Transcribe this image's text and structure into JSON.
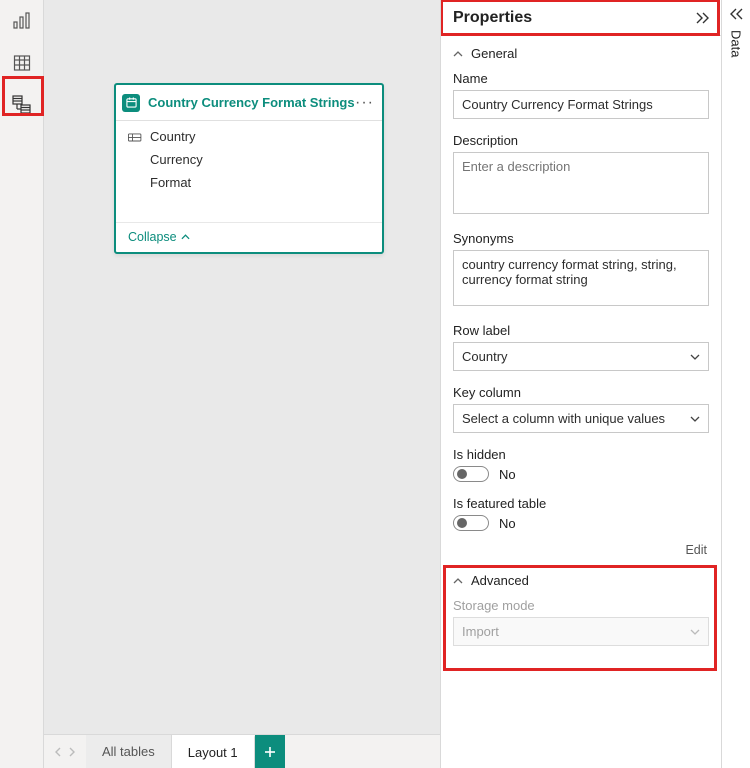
{
  "properties_panel": {
    "title": "Properties",
    "general_heading": "General",
    "name_label": "Name",
    "name_value": "Country Currency Format Strings",
    "description_label": "Description",
    "description_placeholder": "Enter a description",
    "description_value": "",
    "synonyms_label": "Synonyms",
    "synonyms_value": "country currency format string, string, currency format string",
    "row_label_label": "Row label",
    "row_label_value": "Country",
    "key_column_label": "Key column",
    "key_column_value": "Select a column with unique values",
    "is_hidden_label": "Is hidden",
    "is_hidden_value": "No",
    "is_featured_label": "Is featured table",
    "is_featured_value": "No",
    "edit_link": "Edit",
    "advanced_heading": "Advanced",
    "storage_mode_label": "Storage mode",
    "storage_mode_value": "Import"
  },
  "table_card": {
    "title": "Country Currency Format Strings",
    "fields": [
      "Country",
      "Currency",
      "Format"
    ],
    "collapse_label": "Collapse"
  },
  "tabs": {
    "all_tables": "All tables",
    "layout1": "Layout 1"
  },
  "data_rail": {
    "label": "Data"
  },
  "icons": {
    "report": "report-view",
    "data": "data-view",
    "model": "model-view"
  }
}
